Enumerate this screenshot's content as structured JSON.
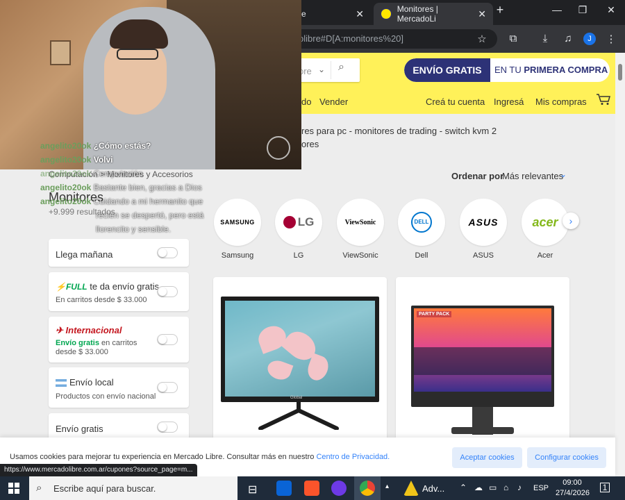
{
  "browser": {
    "tab_prev_title": "e",
    "tab_active_title": "Monitores | MercadoLi",
    "new_tab": "+",
    "close_glyph": "✕",
    "url_partial": "olibre#D[A:monitores%20]",
    "profile_initial": "J",
    "window_controls": [
      "—",
      "❐",
      "✕"
    ]
  },
  "header": {
    "category_label": "ore",
    "promo_left": "ENVÍO GRATIS",
    "promo_right_prefix": "EN TU",
    "promo_right_bold": "PRIMERA COMPRA",
    "nav_left": [
      "do",
      "Vender"
    ],
    "nav_right": [
      "Creá tu cuenta",
      "Ingresá",
      "Mis compras"
    ]
  },
  "chat": {
    "lines": [
      {
        "user": "angelito20ok",
        "msg": "¿Cómo estás?"
      },
      {
        "user": "angelito20ok",
        "msg": "Volvi"
      },
      {
        "user": "angelito20ok",
        "msg": "Computación",
        "dim": true
      },
      {
        "user": "angelito20ok",
        "msg": "Bastante bien, gracias a Dios",
        "dim": true
      },
      {
        "user": "angelito20ok",
        "msg": "Cuidando a mi hermanito que",
        "dim": true
      }
    ],
    "continuation": "recién se despertó, pero está llorencito y sensible."
  },
  "related": {
    "line1": "res para pc   -   monitores de trading   -   switch kvm 2",
    "line2": "ores"
  },
  "listing": {
    "breadcrumb": "Computación > Monitores y Accesorios",
    "title": "Monitores",
    "result_count": "+9.999 resultados",
    "sort_label": "Ordenar por",
    "sort_value": "Más relevantes",
    "sort_chevron": "⌄"
  },
  "filters": {
    "llega_manana": "Llega mañana",
    "full_badge": "FULL",
    "full_title": "te da envío gratis",
    "full_sub": "En carritos desde $ 33.000",
    "intl_badge": "Internacional",
    "intl_green": "Envío gratis",
    "intl_sub": "en carritos desde $ 33.000",
    "local_title": "Envío local",
    "local_sub": "Productos con envío nacional",
    "envio_gratis": "Envío gratis"
  },
  "brands": [
    {
      "logo": "SAMSUNG",
      "name": "Samsung"
    },
    {
      "logo": "LG",
      "name": "LG"
    },
    {
      "logo": "ViewSonic",
      "name": "ViewSonic"
    },
    {
      "logo": "DELL",
      "name": "Dell"
    },
    {
      "logo": "ASUS",
      "name": "ASUS"
    },
    {
      "logo": "acer",
      "name": "Acer"
    }
  ],
  "brands_next": "›",
  "product_images": {
    "monitor1_brand": "Global",
    "monitor2_caption": "PARTY PACK"
  },
  "cookie": {
    "text": "Usamos cookies para mejorar tu experiencia en Mercado Libre. Consultar más en nuestro",
    "link": "Centro de Privacidad.",
    "accept": "Aceptar cookies",
    "configure": "Configurar cookies"
  },
  "status_url": "https://www.mercadolibre.com.ar/cupones?source_page=m...",
  "taskbar": {
    "search_placeholder": "Escribe aquí para buscar.",
    "tray_app_label": "Adv...",
    "language": "ESP",
    "time": "09:00",
    "date": "27/4/2026",
    "notifications": "1"
  },
  "colors": {
    "ml_yellow": "#fff159",
    "ml_blue": "#2d3277",
    "link_blue": "#3483fa",
    "full_green": "#00a650"
  }
}
